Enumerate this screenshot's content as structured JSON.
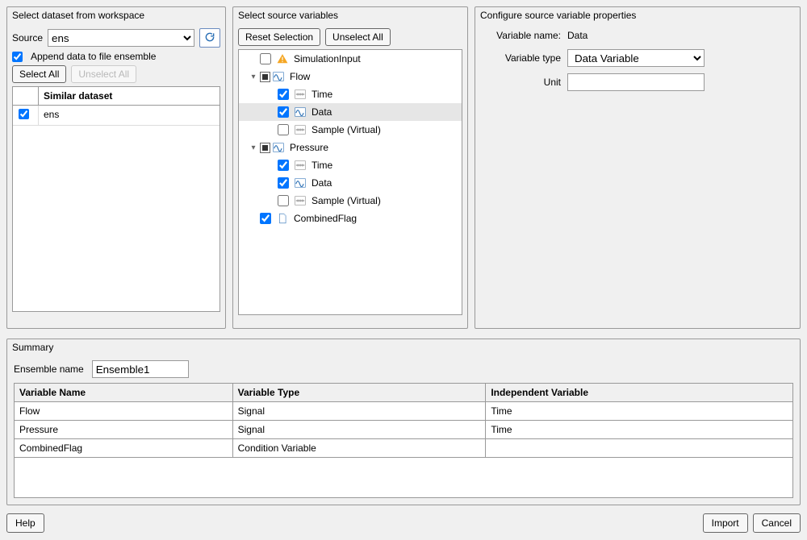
{
  "panels": {
    "dataset_title": "Select dataset from workspace",
    "source_title": "Select source variables",
    "props_title": "Configure source variable properties"
  },
  "dataset": {
    "source_label": "Source",
    "source_value": "ens",
    "append_label": "Append data to file ensemble",
    "append_checked": true,
    "select_all": "Select All",
    "unselect_all": "Unselect All",
    "table_header": "Similar dataset",
    "rows": [
      {
        "checked": true,
        "name": "ens"
      }
    ]
  },
  "source_vars": {
    "reset": "Reset Selection",
    "unselect_all": "Unselect All",
    "tree": [
      {
        "level": 0,
        "expand": "",
        "check": "off",
        "icon": "warning",
        "label": "SimulationInput",
        "selected": false
      },
      {
        "level": 0,
        "expand": "▾",
        "check": "tri",
        "icon": "signal",
        "label": "Flow",
        "selected": false
      },
      {
        "level": 1,
        "expand": "",
        "check": "on",
        "icon": "axis",
        "label": "Time",
        "selected": false
      },
      {
        "level": 1,
        "expand": "",
        "check": "on",
        "icon": "signal",
        "label": "Data",
        "selected": true
      },
      {
        "level": 1,
        "expand": "",
        "check": "off",
        "icon": "axis",
        "label": "Sample (Virtual)",
        "selected": false
      },
      {
        "level": 0,
        "expand": "▾",
        "check": "tri",
        "icon": "signal",
        "label": "Pressure",
        "selected": false
      },
      {
        "level": 1,
        "expand": "",
        "check": "on",
        "icon": "axis",
        "label": "Time",
        "selected": false
      },
      {
        "level": 1,
        "expand": "",
        "check": "on",
        "icon": "signal",
        "label": "Data",
        "selected": false
      },
      {
        "level": 1,
        "expand": "",
        "check": "off",
        "icon": "axis",
        "label": "Sample (Virtual)",
        "selected": false
      },
      {
        "level": 0,
        "expand": "",
        "check": "on",
        "icon": "doc",
        "label": "CombinedFlag",
        "selected": false
      }
    ]
  },
  "properties": {
    "name_label": "Variable name:",
    "name_value": "Data",
    "type_label": "Variable type",
    "type_value": "Data Variable",
    "unit_label": "Unit",
    "unit_value": ""
  },
  "summary": {
    "title": "Summary",
    "ens_label": "Ensemble name",
    "ens_value": "Ensemble1",
    "columns": [
      "Variable Name",
      "Variable Type",
      "Independent Variable"
    ],
    "rows": [
      {
        "name": "Flow",
        "type": "Signal",
        "iv": "Time"
      },
      {
        "name": "Pressure",
        "type": "Signal",
        "iv": "Time"
      },
      {
        "name": "CombinedFlag",
        "type": "Condition Variable",
        "iv": ""
      }
    ]
  },
  "footer": {
    "help": "Help",
    "import": "Import",
    "cancel": "Cancel"
  }
}
